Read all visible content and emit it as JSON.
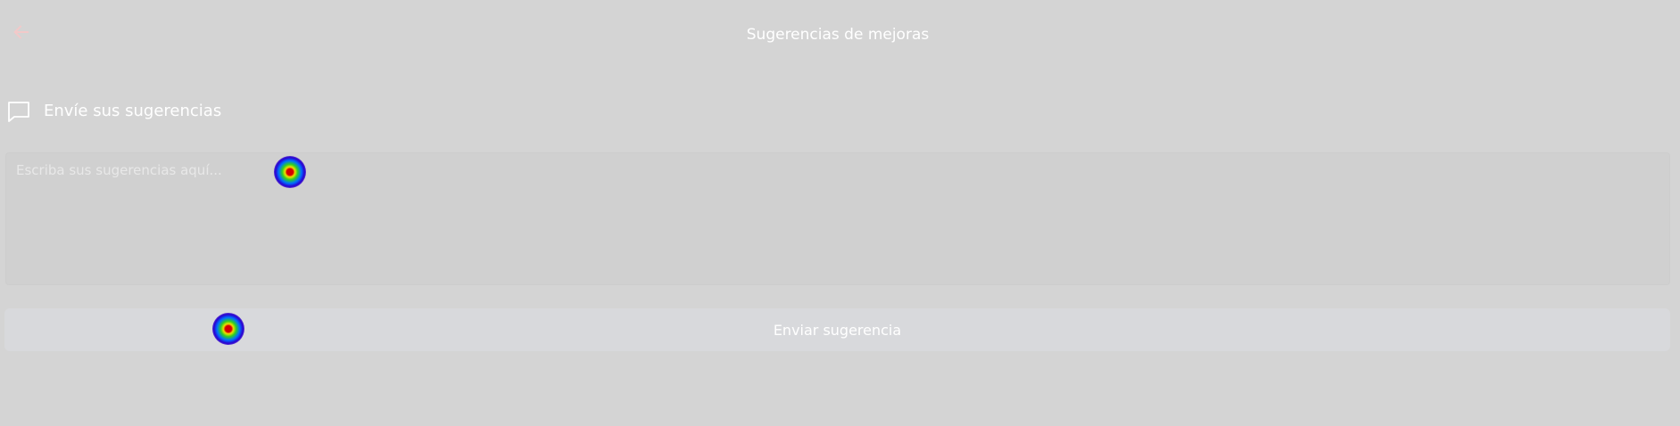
{
  "header": {
    "title": "Sugerencias de mejoras",
    "back_icon": "arrow-left-icon",
    "back_color": "#f2c9c9"
  },
  "section": {
    "icon": "chat-bubble-icon",
    "title": "Envíe sus sugerencias"
  },
  "suggestion_input": {
    "placeholder": "Escriba sus sugerencias aquí...",
    "value": ""
  },
  "submit_button": {
    "label": "Enviar sugerencia"
  },
  "colors": {
    "background": "#d4d4d4",
    "button": "#d8d9dc",
    "text": "#ffffff"
  }
}
